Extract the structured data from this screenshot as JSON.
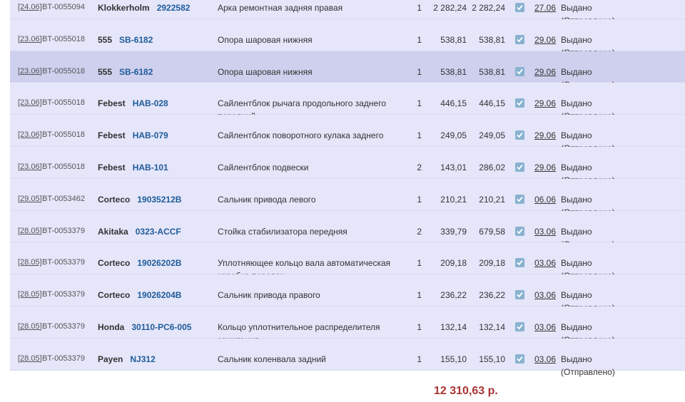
{
  "orders": [
    {
      "date": "[24.06]",
      "doc": "BT-0055094",
      "brand": "Klokkerholm",
      "article": "2922582",
      "name": "Арка ремонтная задняя правая",
      "qty": "1",
      "price": "2 282,24",
      "sum": "2 282,24",
      "delivery": "27.06",
      "status_line1": "Выдано",
      "status_line2": "(Отправлено)"
    },
    {
      "date": "[23.06]",
      "doc": "BT-0055018",
      "brand": "555",
      "article": "SB-6182",
      "name": "Опора шаровая нижняя",
      "qty": "1",
      "price": "538,81",
      "sum": "538,81",
      "delivery": "29.06",
      "status_line1": "Выдано",
      "status_line2": "(Отправлено)"
    },
    {
      "date": "[23.06]",
      "doc": "BT-0055018",
      "brand": "555",
      "article": "SB-6182",
      "name": "Опора шаровая нижняя",
      "qty": "1",
      "price": "538,81",
      "sum": "538,81",
      "delivery": "29.06",
      "status_line1": "Выдано",
      "status_line2": "(Отправлено)",
      "highlighted": true
    },
    {
      "date": "[23.06]",
      "doc": "BT-0055018",
      "brand": "Febest",
      "article": "HAB-028",
      "name": "Сайлентблок рычага продольного заднего передний",
      "qty": "1",
      "price": "446,15",
      "sum": "446,15",
      "delivery": "29.06",
      "status_line1": "Выдано",
      "status_line2": "(Отправлено)"
    },
    {
      "date": "[23.06]",
      "doc": "BT-0055018",
      "brand": "Febest",
      "article": "HAB-079",
      "name": "Сайлентблок поворотного кулака заднего",
      "qty": "1",
      "price": "249,05",
      "sum": "249,05",
      "delivery": "29.06",
      "status_line1": "Выдано",
      "status_line2": "(Отправлено)"
    },
    {
      "date": "[23.06]",
      "doc": "BT-0055018",
      "brand": "Febest",
      "article": "HAB-101",
      "name": "Сайлентблок подвески",
      "qty": "2",
      "price": "143,01",
      "sum": "286,02",
      "delivery": "29.06",
      "status_line1": "Выдано",
      "status_line2": "(Отправлено)"
    },
    {
      "date": "[29.05]",
      "doc": "BT-0053462",
      "brand": "Corteco",
      "article": "19035212B",
      "name": "Сальник привода левого",
      "qty": "1",
      "price": "210,21",
      "sum": "210,21",
      "delivery": "06.06",
      "status_line1": "Выдано",
      "status_line2": "(Отправлено)"
    },
    {
      "date": "[28.05]",
      "doc": "BT-0053379",
      "brand": "Akitaka",
      "article": "0323-ACCF",
      "name": "Стойка стабилизатора передняя",
      "qty": "2",
      "price": "339,79",
      "sum": "679,58",
      "delivery": "03.06",
      "status_line1": "Выдано",
      "status_line2": "(Отправлено)"
    },
    {
      "date": "[28.05]",
      "doc": "BT-0053379",
      "brand": "Corteco",
      "article": "19026202B",
      "name": "Уплотняющее кольцо вала автоматическая коробка передач",
      "qty": "1",
      "price": "209,18",
      "sum": "209,18",
      "delivery": "03.06",
      "status_line1": "Выдано",
      "status_line2": "(Отправлено)"
    },
    {
      "date": "[28.05]",
      "doc": "BT-0053379",
      "brand": "Corteco",
      "article": "19026204B",
      "name": "Сальник привода правого",
      "qty": "1",
      "price": "236,22",
      "sum": "236,22",
      "delivery": "03.06",
      "status_line1": "Выдано",
      "status_line2": "(Отправлено)"
    },
    {
      "date": "[28.05]",
      "doc": "BT-0053379",
      "brand": "Honda",
      "article": "30110-PC6-005",
      "name": "Кольцо уплотнительное распределителя зажигания",
      "qty": "1",
      "price": "132,14",
      "sum": "132,14",
      "delivery": "03.06",
      "status_line1": "Выдано",
      "status_line2": "(Отправлено)"
    },
    {
      "date": "[28.05]",
      "doc": "BT-0053379",
      "brand": "Payen",
      "article": "NJ312",
      "name": "Сальник коленвала задний",
      "qty": "1",
      "price": "155,10",
      "sum": "155,10",
      "delivery": "03.06",
      "status_line1": "Выдано",
      "status_line2": "(Отправлено)"
    }
  ],
  "total": "12 310,63 р.",
  "colors": {
    "row_bg": "#e5e6fa",
    "row_highlight": "#ced0ee",
    "article_link": "#1f5b99",
    "total": "#a83434",
    "checkbox": "#89b2cf"
  },
  "icons": {
    "checked": "checkmark-icon"
  }
}
